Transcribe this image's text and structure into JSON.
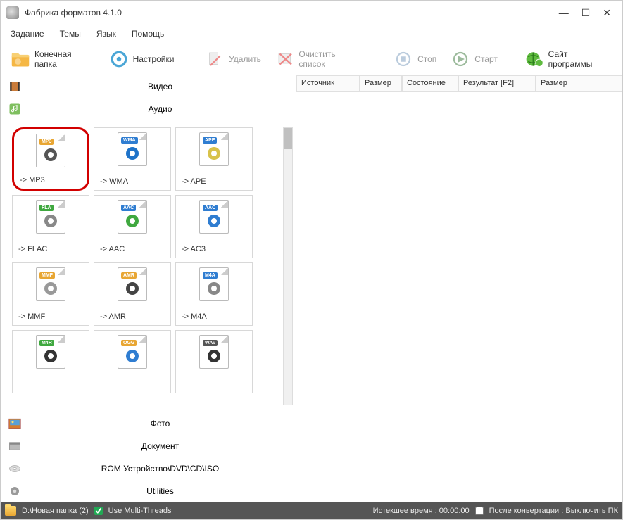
{
  "window": {
    "title": "Фабрика форматов 4.1.0"
  },
  "menu": {
    "task": "Задание",
    "themes": "Темы",
    "language": "Язык",
    "help": "Помощь"
  },
  "toolbar": {
    "output_folder": "Конечная папка",
    "settings": "Настройки",
    "delete": "Удалить",
    "clear_list": "Очистить список",
    "stop": "Стоп",
    "start": "Старт",
    "site": "Сайт программы"
  },
  "categories": {
    "video": "Видео",
    "audio": "Аудио",
    "photo": "Фото",
    "document": "Документ",
    "rom": "ROM Устройство\\DVD\\CD\\ISO",
    "utilities": "Utilities"
  },
  "formats": [
    {
      "label": "-> MP3",
      "tag": "MP3",
      "tag_bg": "#e8a633",
      "accent": "#555",
      "highlight": true
    },
    {
      "label": "-> WMA",
      "tag": "WMA",
      "tag_bg": "#2f7dd1",
      "accent": "#1e73c9"
    },
    {
      "label": "-> APE",
      "tag": "APE",
      "tag_bg": "#2f7dd1",
      "accent": "#d8c24a"
    },
    {
      "label": "-> FLAC",
      "tag": "FLA",
      "tag_bg": "#3fa83f",
      "accent": "#888"
    },
    {
      "label": "-> AAC",
      "tag": "AAC",
      "tag_bg": "#2f7dd1",
      "accent": "#3fa83f"
    },
    {
      "label": "-> AC3",
      "tag": "AAC",
      "tag_bg": "#2f7dd1",
      "accent": "#2f7dd1"
    },
    {
      "label": "-> MMF",
      "tag": "MMF",
      "tag_bg": "#e8a633",
      "accent": "#999"
    },
    {
      "label": "-> AMR",
      "tag": "AMR",
      "tag_bg": "#e8a633",
      "accent": "#444"
    },
    {
      "label": "-> M4A",
      "tag": "M4A",
      "tag_bg": "#2f7dd1",
      "accent": "#888"
    },
    {
      "label": "",
      "tag": "M4R",
      "tag_bg": "#3fa83f",
      "accent": "#333"
    },
    {
      "label": "",
      "tag": "OGG",
      "tag_bg": "#e8a633",
      "accent": "#2f7dd1"
    },
    {
      "label": "",
      "tag": "WAV",
      "tag_bg": "#555555",
      "accent": "#333"
    }
  ],
  "columns": {
    "source": "Источник",
    "size": "Размер",
    "state": "Состояние",
    "result": "Результат [F2]",
    "size2": "Размер"
  },
  "status": {
    "path": "D:\\Новая папка (2)",
    "threads": "Use Multi-Threads",
    "elapsed": "Истекшее время : 00:00:00",
    "after": "После конвертации : Выключить ПК"
  }
}
